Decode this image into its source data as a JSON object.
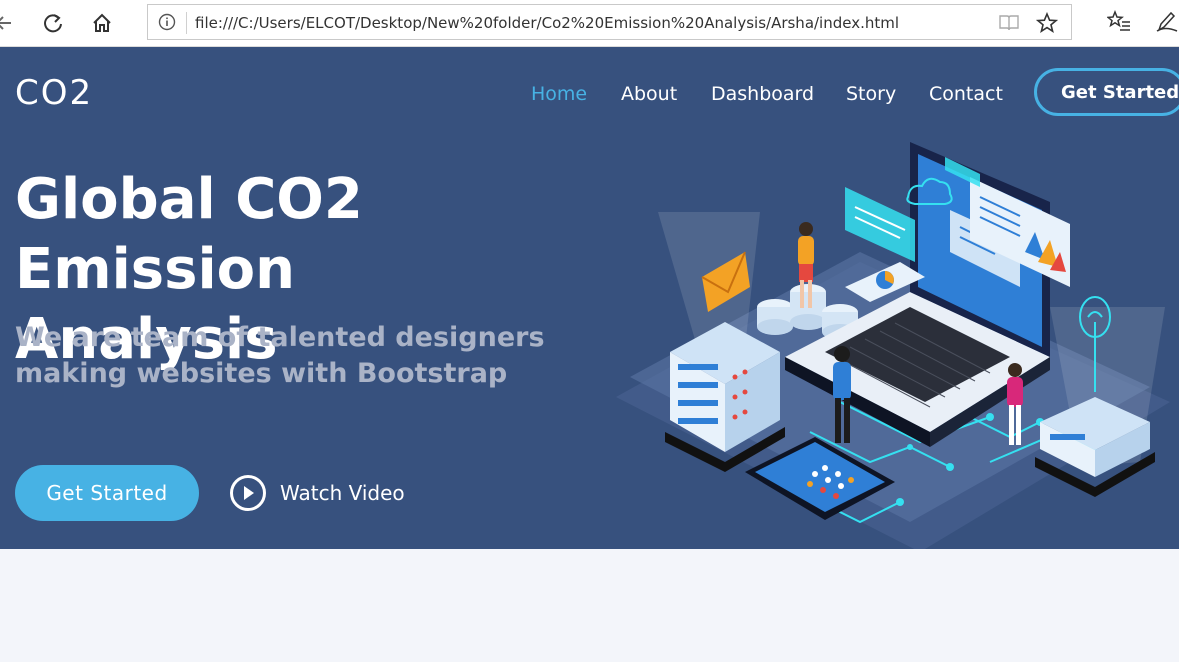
{
  "browser": {
    "url": "file:///C:/Users/ELCOT/Desktop/New%20folder/Co2%20Emission%20Analysis/Arsha/index.html",
    "icons": [
      "back-icon",
      "refresh-icon",
      "home-icon",
      "info-icon",
      "reader-view-icon",
      "favorite-star-icon",
      "favorites-list-icon",
      "pen-icon"
    ]
  },
  "header": {
    "logo": "CO2",
    "nav": [
      "Home",
      "About",
      "Dashboard",
      "Story",
      "Contact"
    ],
    "active": "Home",
    "cta": "Get Started"
  },
  "hero": {
    "title_line1": "Global CO2",
    "title_line2": "Emission Analysis",
    "subtitle": "We are team of talented designers making websites with Bootstrap",
    "primary_button": "Get Started",
    "video_button": "Watch Video"
  },
  "colors": {
    "hero_bg": "#37517e",
    "accent": "#47b2e4",
    "page_bg": "#f3f5fa"
  }
}
